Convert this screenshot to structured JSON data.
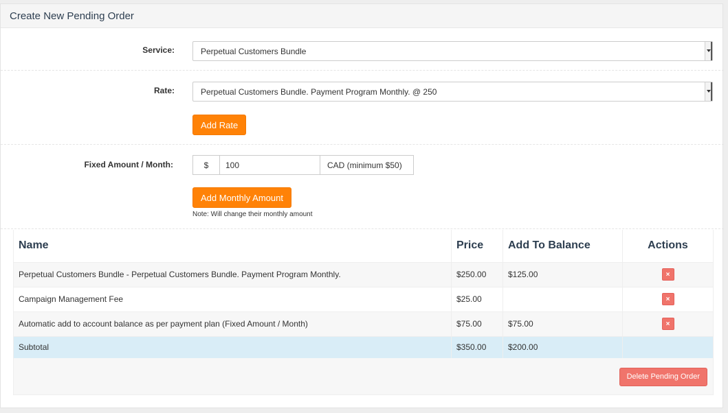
{
  "panel": {
    "title": "Create New Pending Order"
  },
  "service": {
    "label": "Service:",
    "selected": "Perpetual Customers Bundle"
  },
  "rate": {
    "label": "Rate:",
    "selected": "Perpetual Customers Bundle. Payment Program Monthly. @ 250",
    "add_button": "Add Rate"
  },
  "fixed_amount": {
    "label": "Fixed Amount / Month:",
    "prefix": "$",
    "value": "100",
    "suffix": "CAD (minimum $50)",
    "add_button": "Add Monthly Amount",
    "note": "Note: Will change their monthly amount"
  },
  "table": {
    "headers": {
      "name": "Name",
      "price": "Price",
      "add_to_balance": "Add To Balance",
      "actions": "Actions"
    },
    "rows": [
      {
        "name": "Perpetual Customers Bundle - Perpetual Customers Bundle. Payment Program Monthly.",
        "price": "$250.00",
        "add_to_balance": "$125.00",
        "action_icon": "×"
      },
      {
        "name": "Campaign Management Fee",
        "price": "$25.00",
        "add_to_balance": "",
        "action_icon": "×"
      },
      {
        "name": "Automatic add to account balance as per payment plan (Fixed Amount / Month)",
        "price": "$75.00",
        "add_to_balance": "$75.00",
        "action_icon": "×"
      }
    ],
    "subtotal": {
      "label": "Subtotal",
      "price": "$350.00",
      "add_to_balance": "$200.00"
    }
  },
  "footer": {
    "delete_button": "Delete Pending Order"
  },
  "colors": {
    "accent_orange": "#ff8207",
    "danger_red": "#f0746b",
    "subtotal_blue": "#d9edf7",
    "heading_text": "#2d3e50"
  },
  "icons": {
    "select_arrow": "chevron-down-icon",
    "row_delete": "close-icon"
  }
}
